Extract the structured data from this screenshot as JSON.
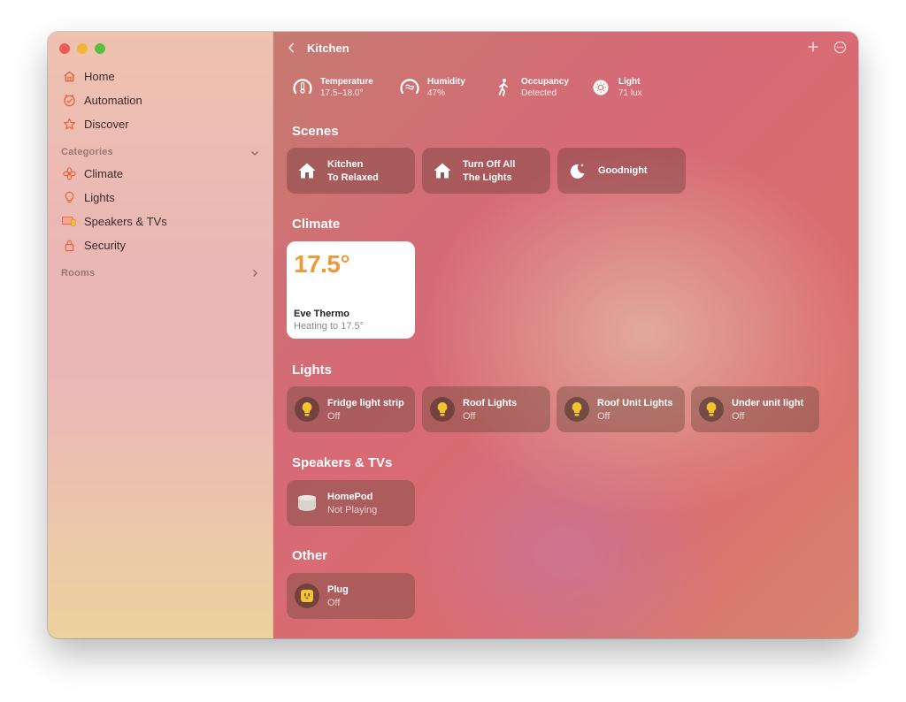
{
  "sidebar": {
    "nav": [
      {
        "label": "Home",
        "icon": "house-icon"
      },
      {
        "label": "Automation",
        "icon": "clock-check-icon"
      },
      {
        "label": "Discover",
        "icon": "star-icon"
      }
    ],
    "categories_label": "Categories",
    "categories": [
      {
        "label": "Climate",
        "icon": "fan-icon"
      },
      {
        "label": "Lights",
        "icon": "lightbulb-icon"
      },
      {
        "label": "Speakers & TVs",
        "icon": "tv-speaker-icon"
      },
      {
        "label": "Security",
        "icon": "lock-icon"
      }
    ],
    "rooms_label": "Rooms"
  },
  "header": {
    "title": "Kitchen"
  },
  "stats": [
    {
      "title": "Temperature",
      "value": "17.5–18.0°",
      "icon": "thermometer-gauge-icon"
    },
    {
      "title": "Humidity",
      "value": "47%",
      "icon": "humidity-gauge-icon"
    },
    {
      "title": "Occupancy",
      "value": "Detected",
      "icon": "walking-person-icon"
    },
    {
      "title": "Light",
      "value": "71 lux",
      "icon": "sun-icon"
    }
  ],
  "sections": {
    "scenes": "Scenes",
    "climate": "Climate",
    "lights": "Lights",
    "speakers": "Speakers & TVs",
    "other": "Other"
  },
  "scenes": [
    {
      "line1": "Kitchen",
      "line2": "To Relaxed",
      "icon": "house-icon"
    },
    {
      "line1": "Turn Off All",
      "line2": "The Lights",
      "icon": "house-icon"
    },
    {
      "line1": "Goodnight",
      "icon": "moon-icon"
    }
  ],
  "climate": {
    "temperature": "17.5°",
    "name": "Eve Thermo",
    "status": "Heating to 17.5°"
  },
  "lights": [
    {
      "name": "Fridge light strip",
      "status": "Off"
    },
    {
      "name": "Roof Lights",
      "status": "Off"
    },
    {
      "name": "Roof Unit Lights",
      "status": "Off"
    },
    {
      "name": "Under unit light",
      "status": "Off"
    }
  ],
  "speakers": [
    {
      "name": "HomePod",
      "status": "Not Playing"
    }
  ],
  "other": [
    {
      "name": "Plug",
      "status": "Off"
    }
  ],
  "colors": {
    "accent": "#e8613a",
    "thermo_temp": "#ee9a3a",
    "bulb": "#f4c430"
  }
}
